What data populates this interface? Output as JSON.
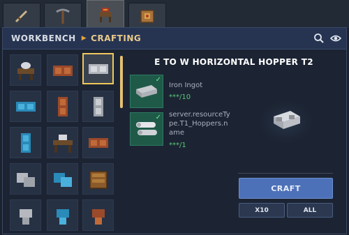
{
  "tabs": [
    {
      "name": "weapons",
      "icon": "sword-icon"
    },
    {
      "name": "tools",
      "icon": "pickaxe-icon"
    },
    {
      "name": "workbench",
      "icon": "workbench-icon",
      "active": true
    },
    {
      "name": "containers",
      "icon": "crate-icon"
    }
  ],
  "header": {
    "breadcrumb_root": "WORKBENCH",
    "breadcrumb_current": "CRAFTING",
    "search_icon": "search-icon",
    "view_icon": "eye-icon"
  },
  "recipe_grid": {
    "selected_index": 2,
    "items": [
      "anvil",
      "red-machine",
      "silver-hopper-selected",
      "blue-hopper",
      "red-hopper-vertical",
      "silver-hopper-vertical",
      "blue-hopper-vertical",
      "bench-table",
      "red-hopper",
      "silver-hopper-diagonal",
      "blue-hopper-diagonal",
      "wood-crate",
      "silver-hopper-down",
      "blue-hopper-down",
      "red-hopper-down"
    ]
  },
  "recipe": {
    "title": "E TO W HORIZONTAL HOPPER T2",
    "ingredients": [
      {
        "name": "Iron Ingot",
        "count": "***/10"
      },
      {
        "name_lines": [
          "server.resourceTy",
          "pe.T1_Hoppers.n",
          "ame"
        ],
        "count": "***/1"
      }
    ],
    "craft_label": "CRAFT",
    "x10_label": "X10",
    "all_label": "ALL"
  },
  "colors": {
    "accent": "#f0c85a",
    "craft_button": "#4d71b8",
    "ingredient_ok": "#1f5a48",
    "count_text": "#59c97a"
  }
}
